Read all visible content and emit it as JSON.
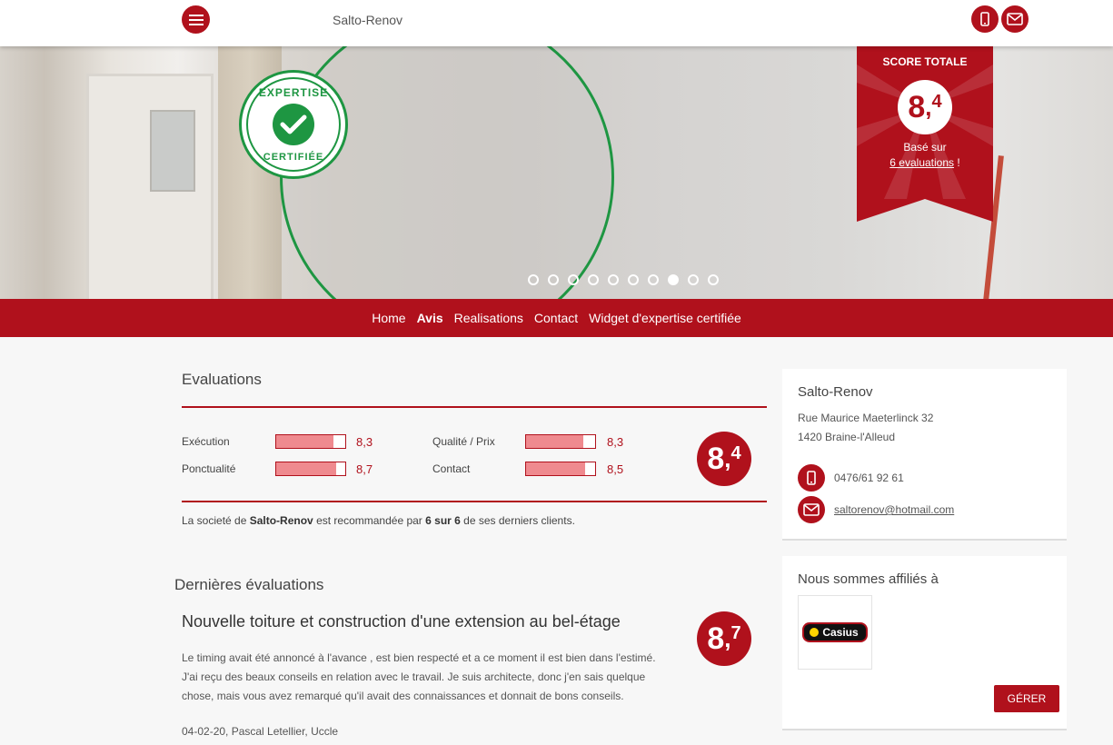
{
  "header": {
    "site_name": "Salto-Renov",
    "menu_icon": "hamburger-icon",
    "phone_icon": "mobile-phone-icon",
    "mail_icon": "envelope-icon"
  },
  "hero": {
    "certif_badge": {
      "top": "EXPERTISE",
      "bottom": "CERTIFIÉE"
    },
    "slides": {
      "count": 10,
      "active_index": 7
    },
    "score": {
      "title": "SCORE TOTALE",
      "int": "8",
      "comma": ",",
      "dec": "4",
      "based_on": "Basé sur",
      "link": "6 evaluations",
      "suffix": " !"
    }
  },
  "nav": {
    "items": [
      {
        "label": "Home",
        "active": false
      },
      {
        "label": "Avis",
        "active": true
      },
      {
        "label": "Realisations",
        "active": false
      },
      {
        "label": "Contact",
        "active": false
      },
      {
        "label": "Widget d'expertise certifiée",
        "active": false
      }
    ]
  },
  "evaluations": {
    "title": "Evaluations",
    "criteria": [
      {
        "label": "Exécution",
        "score": "8,3",
        "value": 8.3
      },
      {
        "label": "Qualité / Prix",
        "score": "8,3",
        "value": 8.3
      },
      {
        "label": "Ponctualité",
        "score": "8,7",
        "value": 8.7
      },
      {
        "label": "Contact",
        "score": "8,5",
        "value": 8.5
      }
    ],
    "total": {
      "int": "8",
      "comma": ",",
      "dec": "4"
    },
    "recommend": {
      "pre": "La societé de ",
      "company": "Salto-Renov",
      "mid": " est recommandée par ",
      "count": "6 sur 6",
      "post": " de ses derniers clients."
    }
  },
  "latest": {
    "title": "Dernières évaluations",
    "review": {
      "title": "Nouvelle toiture et construction d'une extension au bel-étage",
      "text": "Le timing avait été annoncé à l'avance , est bien respecté et a ce moment il est bien dans l'estimé. J'ai reçu des beaux conseils en relation avec le travail. Je suis architecte, donc j'en sais quelque chose, mais vous avez remarqué qu'il avait des connaissances et donnait de bons conseils.",
      "meta": "04-02-20, Pascal Letellier, Uccle",
      "score": {
        "int": "8",
        "comma": ",",
        "dec": "7"
      }
    }
  },
  "sidebar": {
    "company": "Salto-Renov",
    "address1": "Rue Maurice Maeterlinck 32",
    "address2": "1420 Braine-l'Alleud",
    "phone": "0476/61 92 61",
    "email": "saltorenov@hotmail.com",
    "affiliates_title": "Nous sommes affiliés à",
    "affiliate_logo": "Casius",
    "manage_button": "GÉRER"
  },
  "colors": {
    "brand": "#b0111c",
    "green": "#1e9642",
    "bar_fill": "#ef8a8f"
  }
}
